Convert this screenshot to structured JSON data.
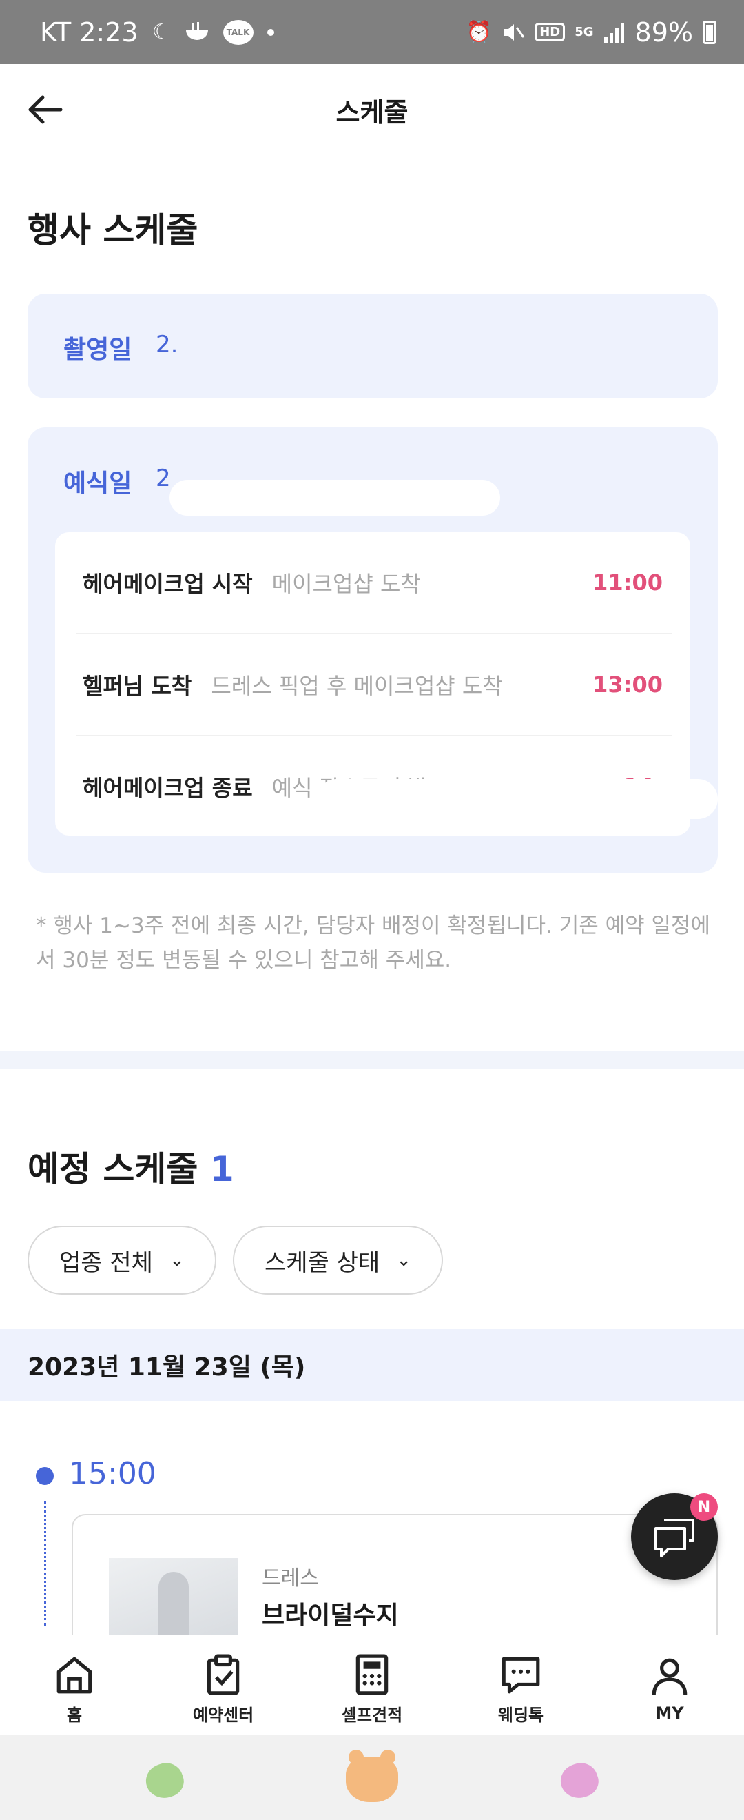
{
  "status_bar": {
    "carrier_time": "KT 2:23",
    "battery": "89%",
    "talk_badge": "TALK",
    "hd": "HD",
    "net": "5G"
  },
  "header": {
    "title": "스케줄"
  },
  "event_schedule": {
    "title": "행사 스케줄",
    "shoot_day": {
      "label": "촬영일",
      "value": "2."
    },
    "wedding_day": {
      "label": "예식일",
      "value": "2"
    },
    "items": [
      {
        "name": "헤어메이크업 시작",
        "desc": "메이크업샵 도착",
        "time": "11:00"
      },
      {
        "name": "헬퍼님 도착",
        "desc": "드레스 픽업 후 메이크업샵 도착",
        "time": "13:00"
      },
      {
        "name": "헤어메이크업 종료",
        "desc": "예식 장소로 출발",
        "time": "14:"
      }
    ],
    "note": "* 행사 1~3주 전에 최종 시간, 담당자 배정이 확정됩니다. 기존 예약 일정에서 30분 정도 변동될 수 있으니 참고해 주세요."
  },
  "upcoming": {
    "title": "예정 스케줄",
    "count": "1",
    "filters": [
      {
        "label": "업종 전체"
      },
      {
        "label": "스케줄 상태"
      }
    ],
    "date": "2023년 11월 23일 (목)",
    "entry": {
      "time": "15:00",
      "category": "드레스",
      "name": "브라이덜수지"
    }
  },
  "chat": {
    "badge": "N"
  },
  "bottom_nav": [
    {
      "label": "홈",
      "icon": "home-icon"
    },
    {
      "label": "예약센터",
      "icon": "clipboard-check-icon"
    },
    {
      "label": "셀프견적",
      "icon": "calculator-icon"
    },
    {
      "label": "웨딩톡",
      "icon": "chat-bubble-icon"
    },
    {
      "label": "MY",
      "icon": "person-icon"
    }
  ],
  "colors": {
    "accent": "#4665d8",
    "time_red": "#e2507a",
    "card_bg": "#eef2fd"
  }
}
